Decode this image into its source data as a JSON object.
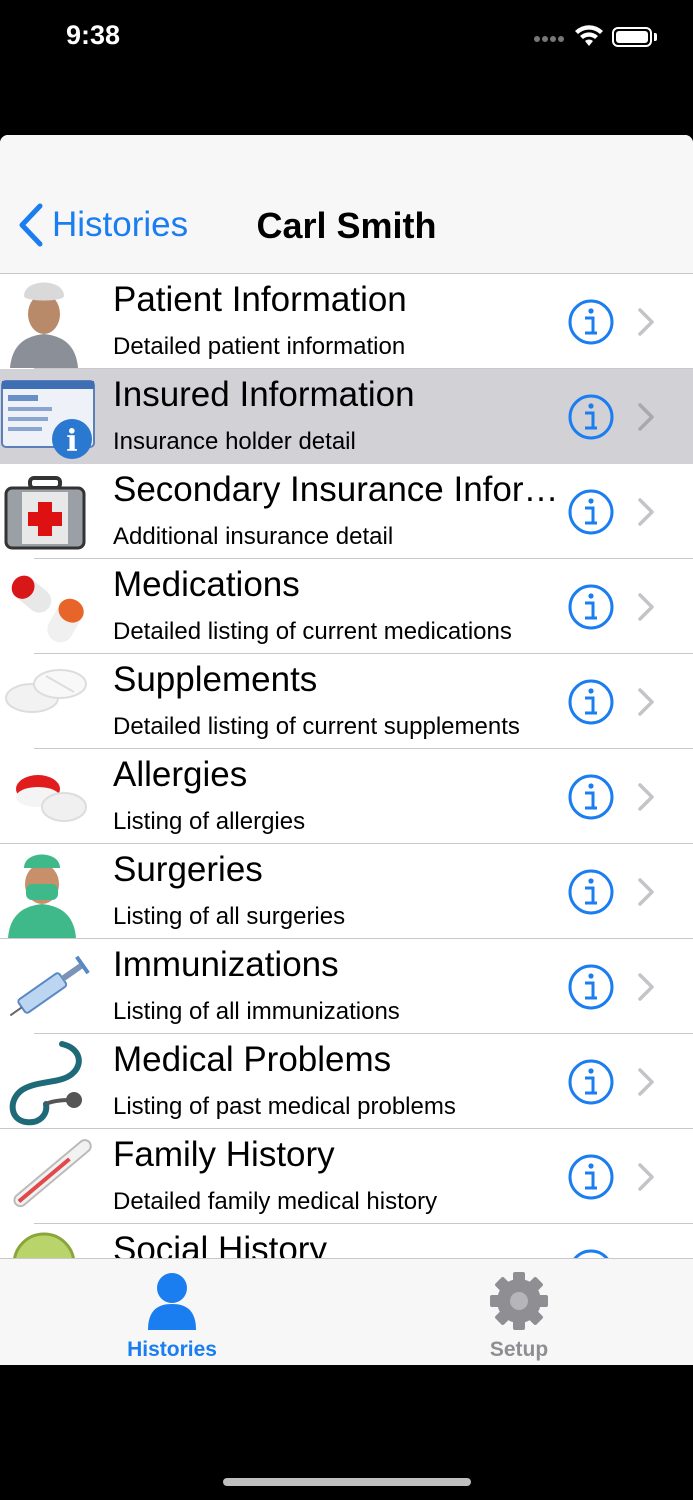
{
  "status_bar": {
    "time": "9:38"
  },
  "nav": {
    "back_label": "Histories",
    "title": "Carl Smith"
  },
  "rows": [
    {
      "title": "Patient Information",
      "subtitle": "Detailed patient information",
      "icon": "patient-icon",
      "selected": false
    },
    {
      "title": "Insured Information",
      "subtitle": "Insurance holder detail",
      "icon": "insurance-card-icon",
      "selected": true
    },
    {
      "title": "Secondary Insurance Information",
      "subtitle": "Additional insurance detail",
      "icon": "first-aid-kit-icon",
      "selected": false
    },
    {
      "title": "Medications",
      "subtitle": "Detailed listing of current medications",
      "icon": "capsules-icon",
      "selected": false
    },
    {
      "title": "Supplements",
      "subtitle": "Detailed listing of current supplements",
      "icon": "tablets-icon",
      "selected": false
    },
    {
      "title": "Allergies",
      "subtitle": "Listing of allergies",
      "icon": "pills-icon",
      "selected": false
    },
    {
      "title": "Surgeries",
      "subtitle": "Listing of all surgeries",
      "icon": "surgeon-icon",
      "selected": false
    },
    {
      "title": "Immunizations",
      "subtitle": "Listing of all immunizations",
      "icon": "syringe-icon",
      "selected": false
    },
    {
      "title": "Medical Problems",
      "subtitle": "Listing of past medical problems",
      "icon": "stethoscope-icon",
      "selected": false
    },
    {
      "title": "Family History",
      "subtitle": "Detailed family medical history",
      "icon": "thermometer-icon",
      "selected": false
    },
    {
      "title": "Social History",
      "subtitle": "",
      "icon": "social-icon",
      "selected": false
    }
  ],
  "tabs": [
    {
      "label": "Histories",
      "icon": "person-icon",
      "active": true
    },
    {
      "label": "Setup",
      "icon": "gear-icon",
      "active": false
    }
  ],
  "colors": {
    "accent": "#1a7df0",
    "inactive": "#8e8e93",
    "selected_row": "#d1d1d6"
  }
}
